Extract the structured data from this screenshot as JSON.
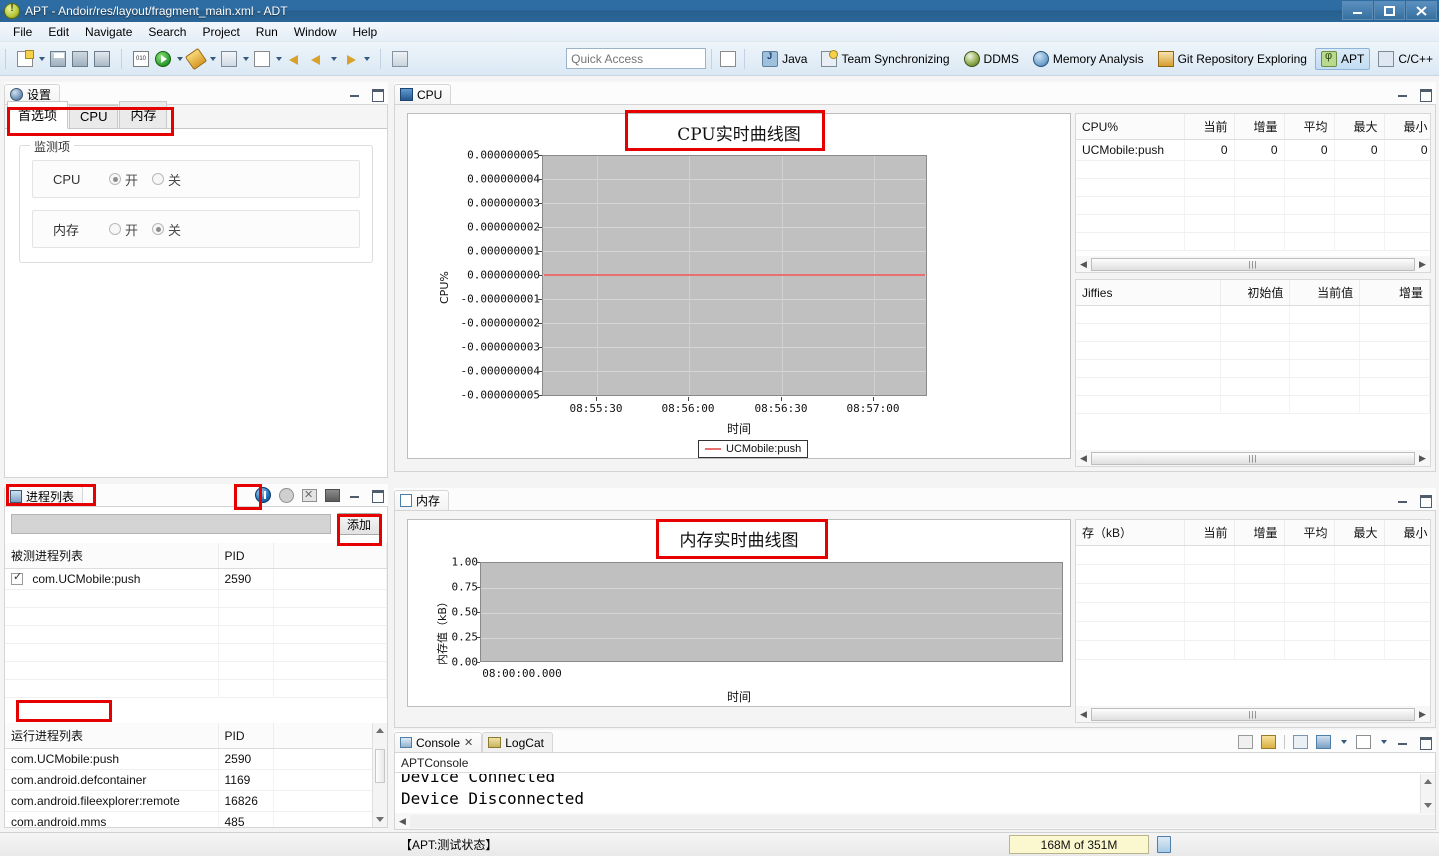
{
  "window": {
    "title": "APT - Andoir/res/layout/fragment_main.xml - ADT",
    "app_icon": "warning-circle-icon",
    "minimize": "–",
    "maximize": "❐",
    "close": "✕"
  },
  "menubar": {
    "items": [
      "File",
      "Edit",
      "Navigate",
      "Search",
      "Project",
      "Run",
      "Window",
      "Help"
    ]
  },
  "toolbar": {
    "quick_access_placeholder": "Quick Access",
    "groups": [
      {
        "buttons": [
          {
            "name": "new-icon",
            "has_arrow": true
          },
          {
            "name": "save-icon",
            "has_arrow": false
          },
          {
            "name": "save-all-icon",
            "has_arrow": false
          },
          {
            "name": "print-icon",
            "has_arrow": false
          }
        ]
      },
      {
        "buttons": [
          {
            "name": "toggle-breakpoint-icon",
            "has_arrow": false
          },
          {
            "name": "run-icon",
            "has_arrow": true
          },
          {
            "name": "debug-icon",
            "has_arrow": true
          },
          {
            "name": "external-tools-icon",
            "has_arrow": true
          },
          {
            "name": "new-android-icon",
            "has_arrow": true
          },
          {
            "name": "back-icon",
            "has_arrow": false
          },
          {
            "name": "forward-icon",
            "has_arrow": true
          },
          {
            "name": "next-annotation-icon",
            "has_arrow": true
          }
        ]
      },
      {
        "buttons": [
          {
            "name": "pin-editor-icon",
            "has_arrow": false
          }
        ]
      }
    ],
    "perspectives": [
      {
        "label": "Java",
        "icon": "java-perspective-icon",
        "active": false
      },
      {
        "label": "Team Synchronizing",
        "icon": "team-sync-icon",
        "active": false
      },
      {
        "label": "DDMS",
        "icon": "ddms-icon",
        "active": false
      },
      {
        "label": "Memory Analysis",
        "icon": "memory-analysis-icon",
        "active": false
      },
      {
        "label": "Git Repository Exploring",
        "icon": "git-icon",
        "active": false
      },
      {
        "label": "APT",
        "icon": "apt-icon",
        "active": true
      },
      {
        "label": "C/C++",
        "icon": "cpp-icon",
        "active": false
      }
    ],
    "open_perspective_icon": "open-perspective-icon"
  },
  "settings_view": {
    "tab_label": "设置",
    "tab_icon": "gear-icon",
    "tabs": [
      {
        "label": "首选项",
        "active": true
      },
      {
        "label": "CPU",
        "active": false
      },
      {
        "label": "内存",
        "active": false
      }
    ],
    "group_title": "监测项",
    "options": [
      {
        "label": "CPU",
        "on_label": "开",
        "off_label": "关",
        "selected": "on"
      },
      {
        "label": "内存",
        "on_label": "开",
        "off_label": "关",
        "selected": "off"
      }
    ]
  },
  "process_view": {
    "tab_label": "进程列表",
    "tab_icon": "list-icon",
    "toolbar_icons": [
      "pause-icon",
      "stop-icon",
      "clear-icon",
      "device-icon"
    ],
    "filter_value": "",
    "add_button": "添加",
    "monitored": {
      "columns": [
        "被测进程列表",
        "PID",
        ""
      ],
      "rows": [
        {
          "checked": true,
          "name": "com.UCMobile:push",
          "pid": "2590"
        }
      ]
    },
    "running": {
      "columns": [
        "运行进程列表",
        "PID",
        ""
      ],
      "rows": [
        {
          "name": "com.UCMobile:push",
          "pid": "2590"
        },
        {
          "name": "com.android.defcontainer",
          "pid": "1169"
        },
        {
          "name": "com.android.fileexplorer:remote",
          "pid": "16826"
        },
        {
          "name": "com.android.mms",
          "pid": "485"
        }
      ]
    }
  },
  "cpu_view": {
    "tab_label": "CPU",
    "tab_icon": "cpu-chart-icon",
    "table": {
      "columns": [
        "CPU%",
        "当前",
        "增量",
        "平均",
        "最大",
        "最小"
      ],
      "rows": [
        {
          "name": "UCMobile:push",
          "current": "0",
          "delta": "0",
          "avg": "0",
          "max": "0",
          "min": "0"
        }
      ]
    },
    "jiffies_table": {
      "columns": [
        "Jiffies",
        "初始值",
        "当前值",
        "增量"
      ],
      "rows": []
    }
  },
  "memory_view": {
    "tab_label": "内存",
    "tab_icon": "memory-chart-icon",
    "table": {
      "columns": [
        "存（kB）",
        "当前",
        "增量",
        "平均",
        "最大",
        "最小"
      ],
      "rows": []
    }
  },
  "console_view": {
    "tabs": [
      {
        "label": "Console",
        "icon": "console-icon",
        "active": true,
        "closable": true
      },
      {
        "label": "LogCat",
        "icon": "logcat-icon",
        "active": false,
        "closable": false
      }
    ],
    "console_name": "APTConsole",
    "lines": [
      "Device Connected",
      "Device Disconnected"
    ],
    "toolbar_icons": [
      "scroll-lock-icon",
      "pin-console-icon",
      "clear-console-icon",
      "display-console-icon",
      "open-console-icon"
    ]
  },
  "statusbar": {
    "status_text": "【APT:测试状态】",
    "heap_text": "168M of 351M",
    "trash_icon": "trash-icon"
  },
  "chart_data": [
    {
      "type": "line",
      "title": "CPU实时曲线图",
      "xlabel": "时间",
      "ylabel": "CPU%",
      "yticks": [
        "0.000000005",
        "0.000000004",
        "0.000000003",
        "0.000000002",
        "0.000000001",
        "0.000000000",
        "-0.000000001",
        "-0.000000002",
        "-0.000000003",
        "-0.000000004",
        "-0.000000005"
      ],
      "ylim": [
        -5e-09,
        5e-09
      ],
      "xticks": [
        "08:55:30",
        "08:56:00",
        "08:56:30",
        "08:57:00"
      ],
      "grid": true,
      "legend": [
        {
          "name": "UCMobile:push",
          "color": "#e8706f"
        }
      ],
      "legend_position": "bottom",
      "series": [
        {
          "name": "UCMobile:push",
          "values": [
            0,
            0,
            0,
            0,
            0
          ],
          "color": "#e8706f"
        }
      ],
      "plot_bg": "#c0c0c0"
    },
    {
      "type": "line",
      "title": "内存实时曲线图",
      "xlabel": "时间",
      "ylabel": "内存值（kB）",
      "yticks": [
        "1.00",
        "0.75",
        "0.50",
        "0.25",
        "0.00"
      ],
      "ylim": [
        0,
        1
      ],
      "xticks": [
        "08:00:00.000"
      ],
      "grid": true,
      "legend": [],
      "series": [],
      "plot_bg": "#c0c0c0"
    }
  ]
}
